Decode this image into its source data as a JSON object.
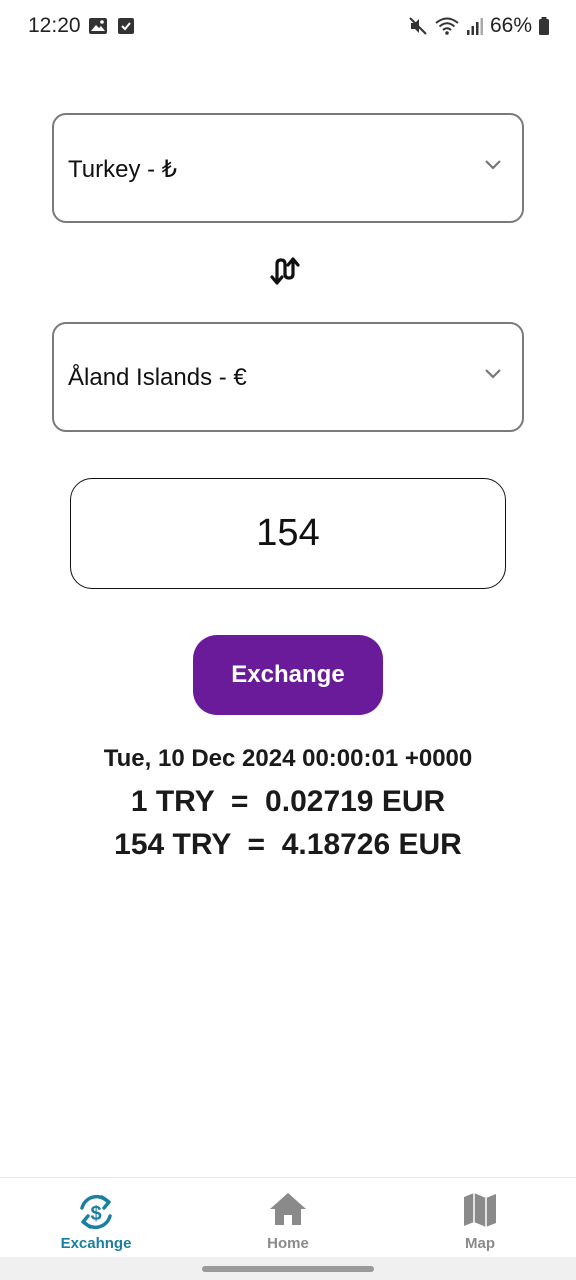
{
  "status_bar": {
    "time": "12:20",
    "battery": "66%",
    "left_icons": [
      "image-icon",
      "check-square-icon"
    ],
    "right_icons": [
      "mute-icon",
      "wifi-icon",
      "signal-icon",
      "battery-icon"
    ]
  },
  "converter": {
    "from_currency": "Turkey - ₺",
    "to_currency": "Åland Islands - €",
    "amount": "154",
    "exchange_label": "Exchange",
    "swap_icon": "swap-vertical-icon"
  },
  "result": {
    "date": "Tue, 10 Dec 2024 00:00:01 +0000",
    "rate_line": "1 TRY  =  0.02719 EUR",
    "total_line": "154 TRY  =  4.18726 EUR"
  },
  "bottom_nav": {
    "items": [
      {
        "label": "Excahnge",
        "icon": "currency-exchange-icon",
        "active": true
      },
      {
        "label": "Home",
        "icon": "home-icon",
        "active": false
      },
      {
        "label": "Map",
        "icon": "map-icon",
        "active": false
      }
    ]
  },
  "colors": {
    "primary": "#6a1b9a",
    "active_nav": "#1a7fa0",
    "inactive_nav": "#8a8a8a",
    "border": "#7a7a7a"
  }
}
